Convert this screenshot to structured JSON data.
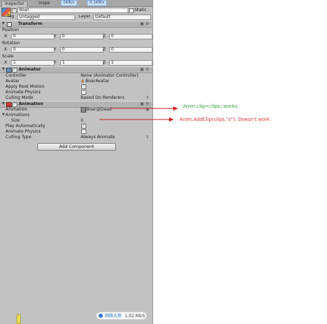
{
  "tabs": [
    "Inspector",
    "Inspe"
  ],
  "overlays": [
    "0KB/s",
    "0.1KB/s"
  ],
  "object": {
    "name": "Boar",
    "static_label": "Static",
    "tag_label": "Tag",
    "tag_value": "Untagged",
    "layer_label": "Layer",
    "layer_value": "Default"
  },
  "transform": {
    "title": "Transform",
    "rows": [
      {
        "label": "Position",
        "x": "0",
        "y": "0",
        "z": "0"
      },
      {
        "label": "Rotation",
        "x": "0",
        "y": "0",
        "z": "0"
      },
      {
        "label": "Scale",
        "x": "1",
        "y": "1",
        "z": "1"
      }
    ]
  },
  "animator": {
    "title": "Animator",
    "rows": [
      {
        "label": "Controller",
        "value": "None (Animator Controller)"
      },
      {
        "label": "Avatar",
        "value": "BoarAvatar"
      },
      {
        "label": "Apply Root Motion",
        "value": "✓"
      },
      {
        "label": "Animate Physics",
        "value": ""
      },
      {
        "label": "Culling Mode",
        "value": "Based On Renderers"
      }
    ]
  },
  "animation": {
    "title": "Animation",
    "animation_label": "Animation",
    "animation_value": "Boar@Dead",
    "animations_label": "Animations",
    "size_label": "Size",
    "size_value": "0",
    "play_auto_label": "Play Automatically",
    "play_auto_value": "✓",
    "animate_physics_label": "Animate Physics",
    "animate_physics_value": "",
    "culling_label": "Culling Type",
    "culling_value": "Always Animate"
  },
  "add_component_label": "Add Component",
  "annotations": {
    "note1": "Anim.clip=clips; works",
    "note2": "Anim.AddClip(clips,\"s\"); Doesn't work"
  },
  "net_widget": {
    "label": "网络占用",
    "value": "1.02 KB/S"
  },
  "colors": {
    "note1": "#3a9a3a",
    "note2": "#d83030",
    "arrow": "#c81e1e"
  },
  "icons": [
    "cube-icon",
    "gear-icon",
    "help-icon",
    "chevron-down-icon",
    "animator-icon",
    "animation-icon"
  ]
}
